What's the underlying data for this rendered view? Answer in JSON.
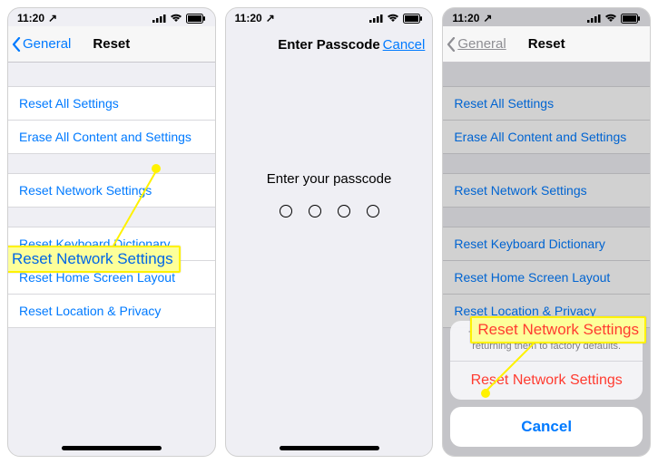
{
  "status": {
    "time": "11:20",
    "location_arrow": "↗"
  },
  "screen1": {
    "back_label": "General",
    "title": "Reset",
    "items_g1": [
      "Reset All Settings",
      "Erase All Content and Settings"
    ],
    "items_g2": [
      "Reset Network Settings"
    ],
    "items_g3": [
      "Reset Keyboard Dictionary",
      "Reset Home Screen Layout",
      "Reset Location & Privacy"
    ],
    "callout": "Reset Network Settings"
  },
  "screen2": {
    "title": "Enter Passcode",
    "cancel": "Cancel",
    "prompt": "Enter your passcode"
  },
  "screen3": {
    "back_label": "General",
    "title": "Reset",
    "items_g1": [
      "Reset All Settings",
      "Erase All Content and Settings"
    ],
    "items_g2": [
      "Reset Network Settings"
    ],
    "items_g3": [
      "Reset Keyboard Dictionary",
      "Reset Home Screen Layout",
      "Reset Location & Privacy"
    ],
    "sheet_desc": "This will delete all network settings, returning them to factory defaults.",
    "sheet_action": "Reset Network Settings",
    "sheet_cancel": "Cancel",
    "callout": "Reset Network Settings"
  }
}
